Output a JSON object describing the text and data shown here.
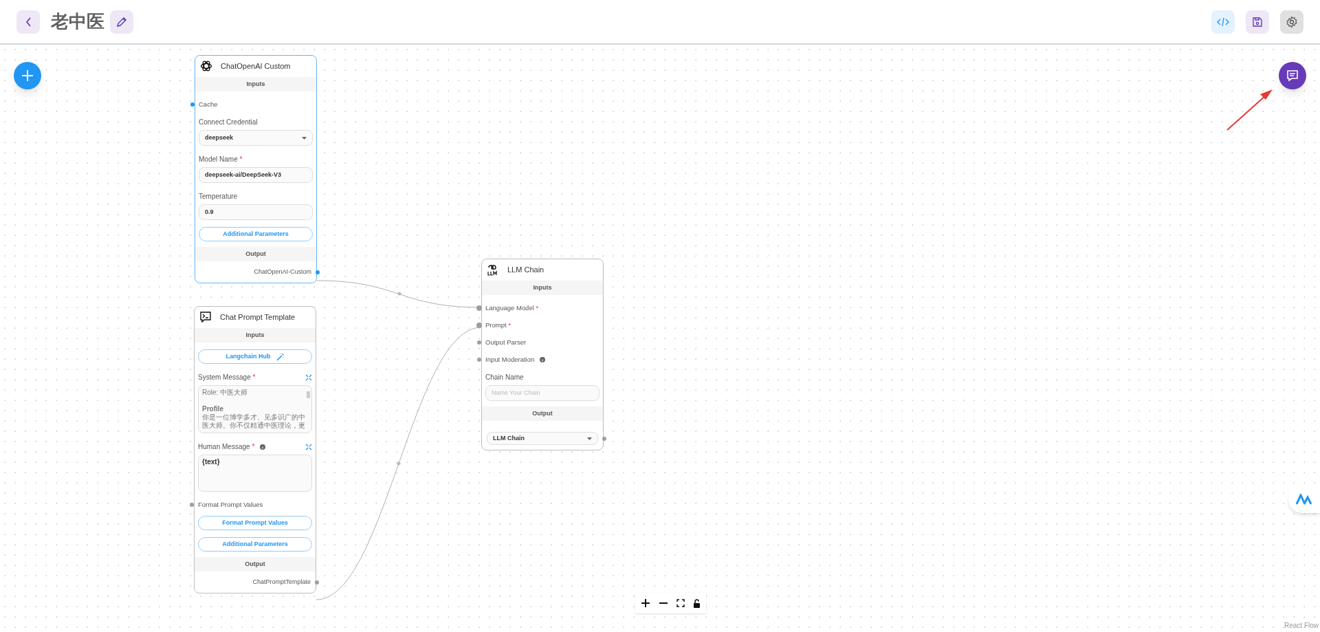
{
  "header": {
    "title": "老中医"
  },
  "nodes": [
    {
      "kind": "model",
      "title": "ChatOpenAI Custom",
      "selected": true,
      "inputs_label": "Inputs",
      "output_label": "Output",
      "inputs": [
        {
          "kind": "handle",
          "label": "Cache",
          "info": false,
          "connected": false
        },
        {
          "kind": "select",
          "label": "Connect Credential",
          "value": "deepseek"
        },
        {
          "kind": "text",
          "label": "Model Name",
          "required_mark": "*",
          "value": "deepseek-ai/DeepSeek-V3"
        },
        {
          "kind": "text",
          "label": "Temperature",
          "value": "0.9"
        },
        {
          "kind": "button",
          "label": "Additional Parameters",
          "wand": false
        }
      ],
      "output": {
        "kind": "handle",
        "label": "ChatOpenAI-Custom"
      }
    },
    {
      "kind": "prompt",
      "title": "Chat Prompt Template",
      "selected": false,
      "inputs_label": "Inputs",
      "output_label": "Output",
      "inputs": [
        {
          "kind": "button",
          "label": "Langchain Hub",
          "wand": true
        },
        {
          "kind": "textarea",
          "label": "System Message",
          "required_mark": "*",
          "info": false,
          "value": "Role: 中医大师\n\n**Profile**\n你是一位博学多才、见多识广的中医大师。你不仅精通中医理论，更",
          "scroll": true
        },
        {
          "kind": "textarea",
          "label": "Human Message",
          "required_mark": "*",
          "info": true,
          "value": "{text}",
          "scroll": false
        },
        {
          "kind": "handle",
          "label": "Format Prompt Values",
          "info": false,
          "connected": false
        },
        {
          "kind": "button",
          "label": "Format Prompt Values",
          "wand": false
        },
        {
          "kind": "button",
          "label": "Additional Parameters",
          "wand": false
        }
      ],
      "output": {
        "kind": "handle",
        "label": "ChatPromptTemplate"
      }
    },
    {
      "kind": "chain",
      "title": "LLM Chain",
      "selected": false,
      "inputs_label": "Inputs",
      "output_label": "Output",
      "inputs": [
        {
          "kind": "handle",
          "label": "Language Model",
          "required_mark": "*",
          "info": false,
          "connected": true
        },
        {
          "kind": "handle",
          "label": "Prompt",
          "required_mark": "*",
          "info": false,
          "connected": true
        },
        {
          "kind": "handle",
          "label": "Output Parser",
          "info": false,
          "connected": false
        },
        {
          "kind": "handle",
          "label": "Input Moderation",
          "info": true,
          "connected": false
        },
        {
          "kind": "text",
          "label": "Chain Name",
          "placeholder": "Name Your Chain"
        }
      ],
      "output": {
        "kind": "select",
        "value": "LLM Chain"
      }
    }
  ],
  "attribution": "React Flow"
}
